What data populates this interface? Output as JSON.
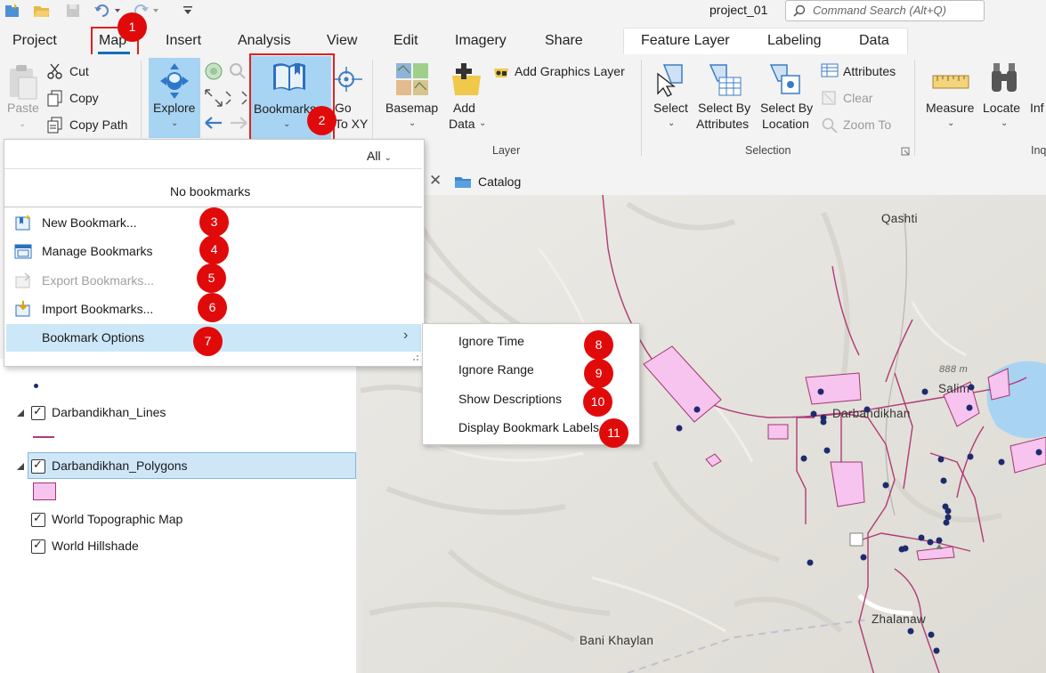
{
  "project_title": "project_01",
  "command_search": {
    "placeholder": "Command Search (Alt+Q)"
  },
  "tabs": [
    "Project",
    "Map",
    "Insert",
    "Analysis",
    "View",
    "Edit",
    "Imagery",
    "Share"
  ],
  "context_tabs": [
    "Feature Layer",
    "Labeling",
    "Data"
  ],
  "ribbon": {
    "clipboard": {
      "paste": "Paste",
      "cut": "Cut",
      "copy": "Copy",
      "copy_path": "Copy Path"
    },
    "navigate": {
      "explore": "Explore",
      "bookmarks": "Bookmarks",
      "go_to_xy_line1": "Go",
      "go_to_xy_line2": "To XY"
    },
    "layer": {
      "basemap": "Basemap",
      "add_data_line1": "Add",
      "add_data_line2": "Data",
      "add_graphics_layer": "Add Graphics Layer",
      "group_label": "Layer"
    },
    "selection": {
      "select": "Select",
      "select_by_attributes_line1": "Select By",
      "select_by_attributes_line2": "Attributes",
      "select_by_location_line1": "Select By",
      "select_by_location_line2": "Location",
      "attributes": "Attributes",
      "clear": "Clear",
      "zoom_to": "Zoom To",
      "group_label": "Selection"
    },
    "inquiry": {
      "measure": "Measure",
      "locate": "Locate",
      "info": "Inf",
      "group_label": "Inq"
    }
  },
  "bookmarks_menu": {
    "filter": "All",
    "empty_text": "No bookmarks",
    "items": [
      {
        "label": "New Bookmark...",
        "enabled": true
      },
      {
        "label": "Manage Bookmarks",
        "enabled": true
      },
      {
        "label": "Export Bookmarks...",
        "enabled": false
      },
      {
        "label": "Import Bookmarks...",
        "enabled": true
      },
      {
        "label": "Bookmark Options",
        "enabled": true,
        "highlighted": true
      }
    ]
  },
  "bookmark_options_submenu": [
    "Ignore Time",
    "Ignore Range",
    "Show Descriptions",
    "Display Bookmark Labels"
  ],
  "badges": [
    "1",
    "2",
    "3",
    "4",
    "5",
    "6",
    "7",
    "8",
    "9",
    "10",
    "11"
  ],
  "catalog_tab": "Catalog",
  "layers": [
    {
      "label": "Darbandikhan_Lines",
      "checked": true
    },
    {
      "label": "Darbandikhan_Polygons",
      "checked": true,
      "selected": true
    },
    {
      "label": "World Topographic Map",
      "checked": true
    },
    {
      "label": "World Hillshade",
      "checked": true
    }
  ],
  "map_labels": {
    "qashti": "Qashti",
    "darbandikhan": "Darbandikhan",
    "salim": "Salim",
    "elevation": "888 m",
    "zhalanaw": "Zhalanaw",
    "bani_khaylan": "Bani Khaylan"
  },
  "colors": {
    "accent": "#106ebe",
    "badge": "#e10a0a",
    "polygon_fill": "#f6c4ef",
    "line": "#b03a76",
    "point": "#1e2a6e",
    "menu_highlight": "#cce8f8"
  }
}
